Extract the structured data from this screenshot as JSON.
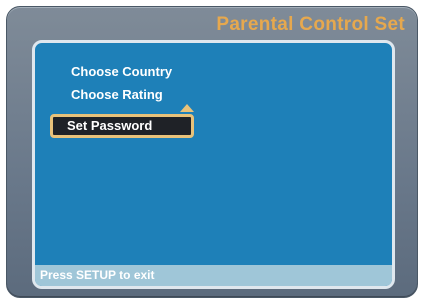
{
  "header": {
    "title": "Parental Control Set"
  },
  "menu": {
    "items": [
      {
        "label": "Choose Country"
      },
      {
        "label": "Choose Rating"
      },
      {
        "label": "Set Password",
        "selected": true
      }
    ]
  },
  "status_bar": {
    "text": "Press SETUP to exit"
  },
  "colors": {
    "title": "#e6a84e",
    "screen_bg": "#1e80b8",
    "frame_bg": "#7a8796",
    "highlight_border": "#e8c27a",
    "highlight_bg": "#1f2227",
    "status_bg": "#9fc6d8"
  },
  "icons": {
    "selection_pointer": "triangle-up-icon"
  }
}
